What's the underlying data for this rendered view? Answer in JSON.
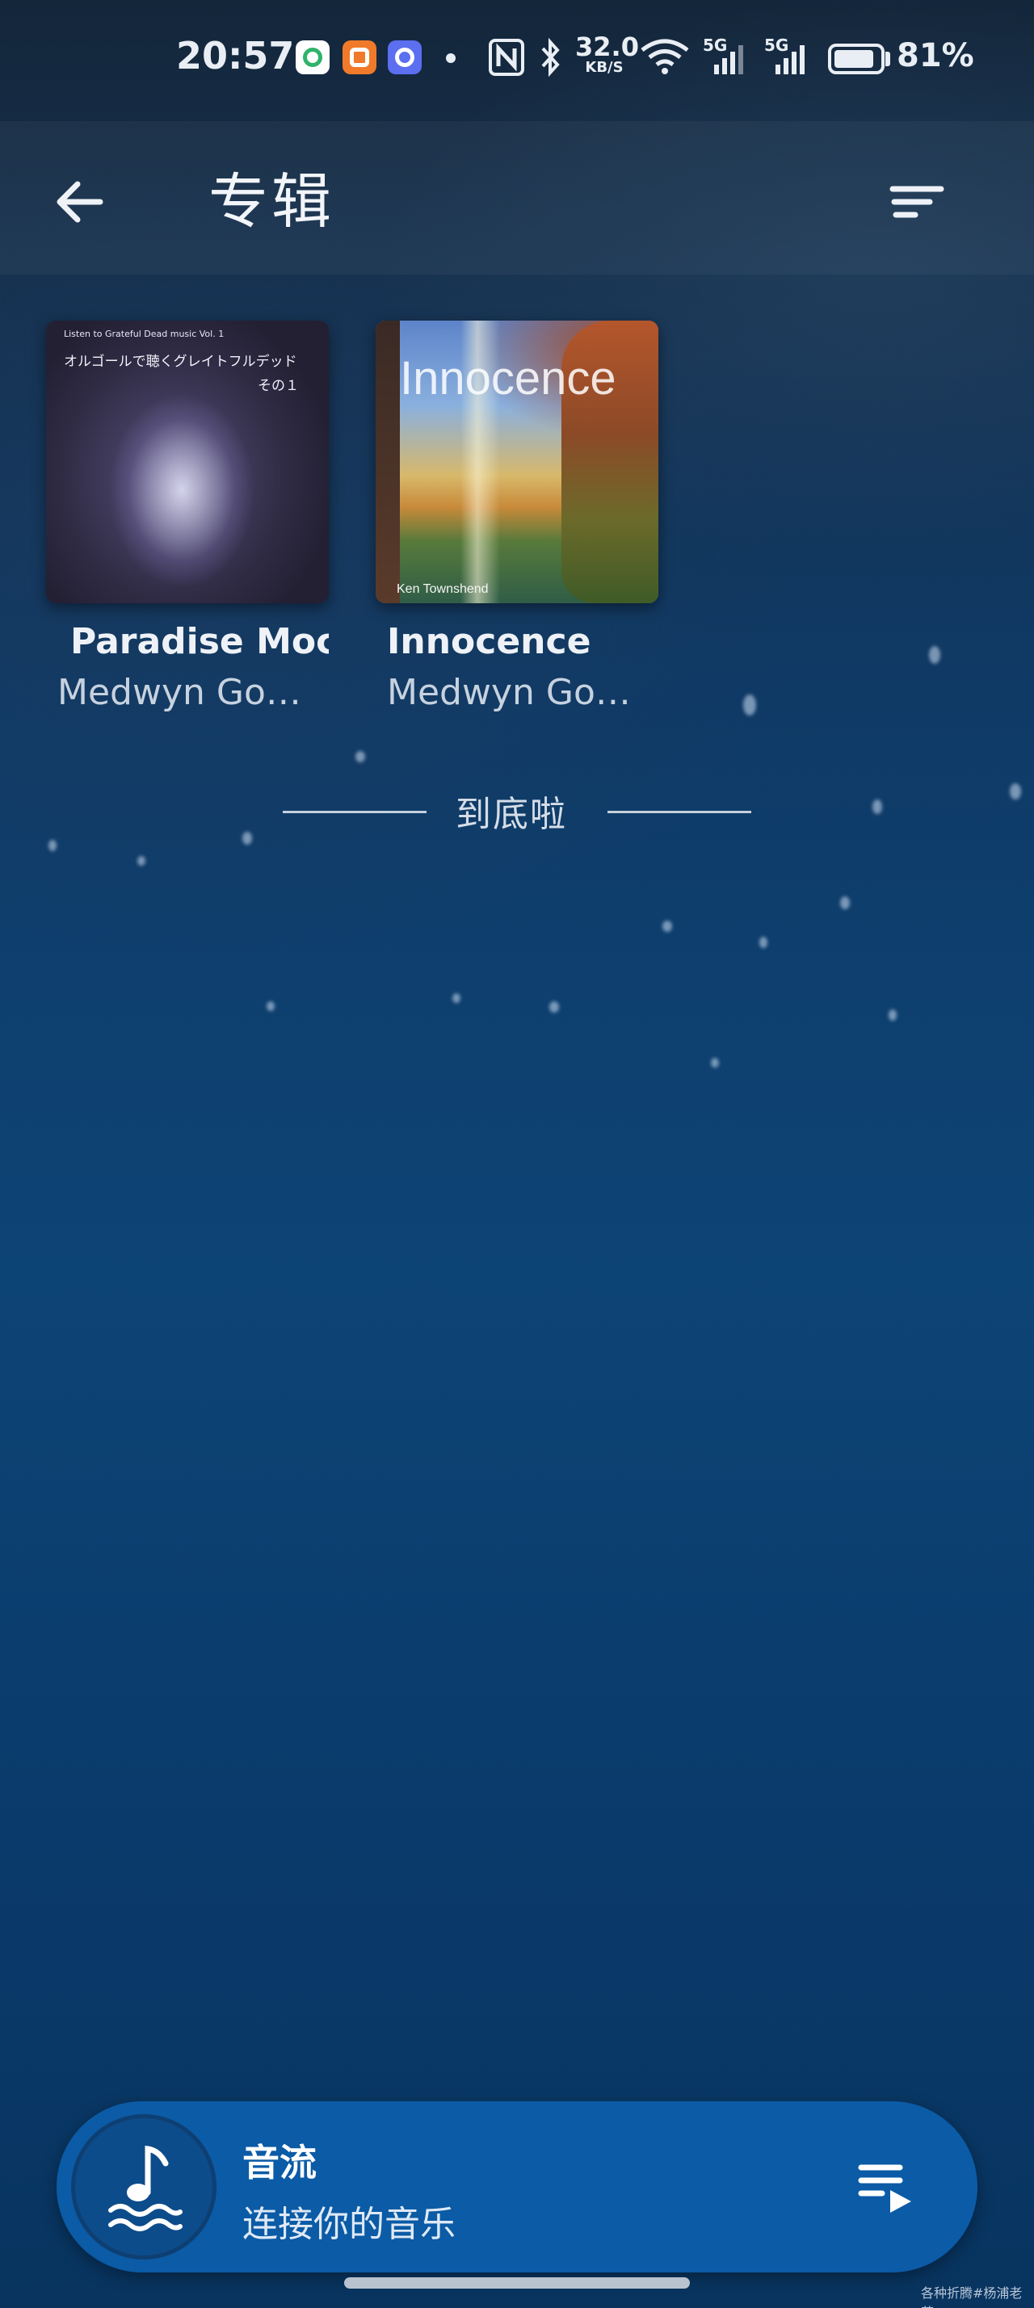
{
  "status_bar": {
    "time": "20:57",
    "network_speed_value": "32.0",
    "network_speed_unit": "KB/S",
    "signal_1_label": "5G",
    "signal_2_label": "5G",
    "battery_percent": "81%",
    "battery_level": 0.81,
    "icons": [
      "app-green-icon",
      "app-orange-icon",
      "app-blue-icon",
      "dot-icon",
      "nfc-icon",
      "bluetooth-icon",
      "wifi-icon",
      "signal-icon",
      "battery-icon"
    ]
  },
  "header": {
    "title": "专辑",
    "back_icon": "arrow-left-icon",
    "sort_icon": "sort-icon"
  },
  "albums": [
    {
      "name": "Paradise Moc",
      "artist": "Medwyn Go…",
      "cover_text_small": "Listen to Grateful Dead music Vol. 1",
      "cover_text_jp": "オルゴールで聴くグレイトフルデッド",
      "cover_text_jp2": "その１"
    },
    {
      "name": "Innocence",
      "artist": "Medwyn Go…",
      "cover_title": "Innocence",
      "cover_artist": "Ken Townshend"
    }
  ],
  "end_text": "到底啦",
  "player": {
    "title": "音流",
    "subtitle": "连接你的音乐",
    "art_icon": "music-note-waves-icon",
    "queue_icon": "playlist-play-icon"
  },
  "watermark": "各种折腾#杨浦老苏",
  "colors": {
    "accent": "#0b5ba6",
    "background_top": "#14263a",
    "background_bottom": "#08345f"
  }
}
